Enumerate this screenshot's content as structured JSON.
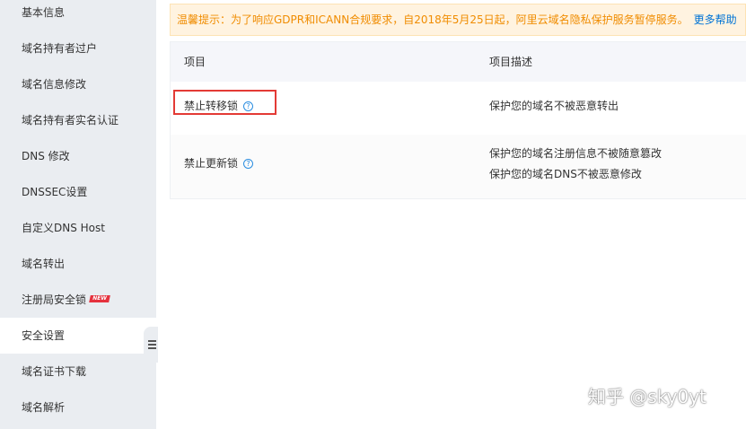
{
  "sidebar": {
    "items": [
      {
        "label": "基本信息"
      },
      {
        "label": "域名持有者过户"
      },
      {
        "label": "域名信息修改"
      },
      {
        "label": "域名持有者实名认证"
      },
      {
        "label": "DNS 修改"
      },
      {
        "label": "DNSSEC设置"
      },
      {
        "label": "自定义DNS Host"
      },
      {
        "label": "域名转出"
      },
      {
        "label": "注册局安全锁",
        "badge": "NEW"
      },
      {
        "label": "安全设置",
        "active": true
      },
      {
        "label": "域名证书下载"
      },
      {
        "label": "域名解析"
      }
    ]
  },
  "notice": {
    "text": "温馨提示：为了响应GDPR和ICANN合规要求，自2018年5月25日起，阿里云域名隐私保护服务暂停服务。",
    "link": "更多帮助"
  },
  "table": {
    "headers": {
      "item": "项目",
      "desc": "项目描述"
    },
    "rows": [
      {
        "name": "禁止转移锁",
        "help_icon": "?",
        "desc": [
          "保护您的域名不被恶意转出"
        ]
      },
      {
        "name": "禁止更新锁",
        "help_icon": "?",
        "desc": [
          "保护您的域名注册信息不被随意篡改",
          "保护您的域名DNS不被恶意修改"
        ]
      }
    ]
  },
  "watermark": "知乎 @sky0yt",
  "colors": {
    "sidebar_bg": "#eaedf1",
    "notice_bg": "#fff3e0",
    "notice_text": "#f08c00",
    "link": "#0073d5",
    "highlight": "#e33a35",
    "badge": "#e5323e"
  }
}
